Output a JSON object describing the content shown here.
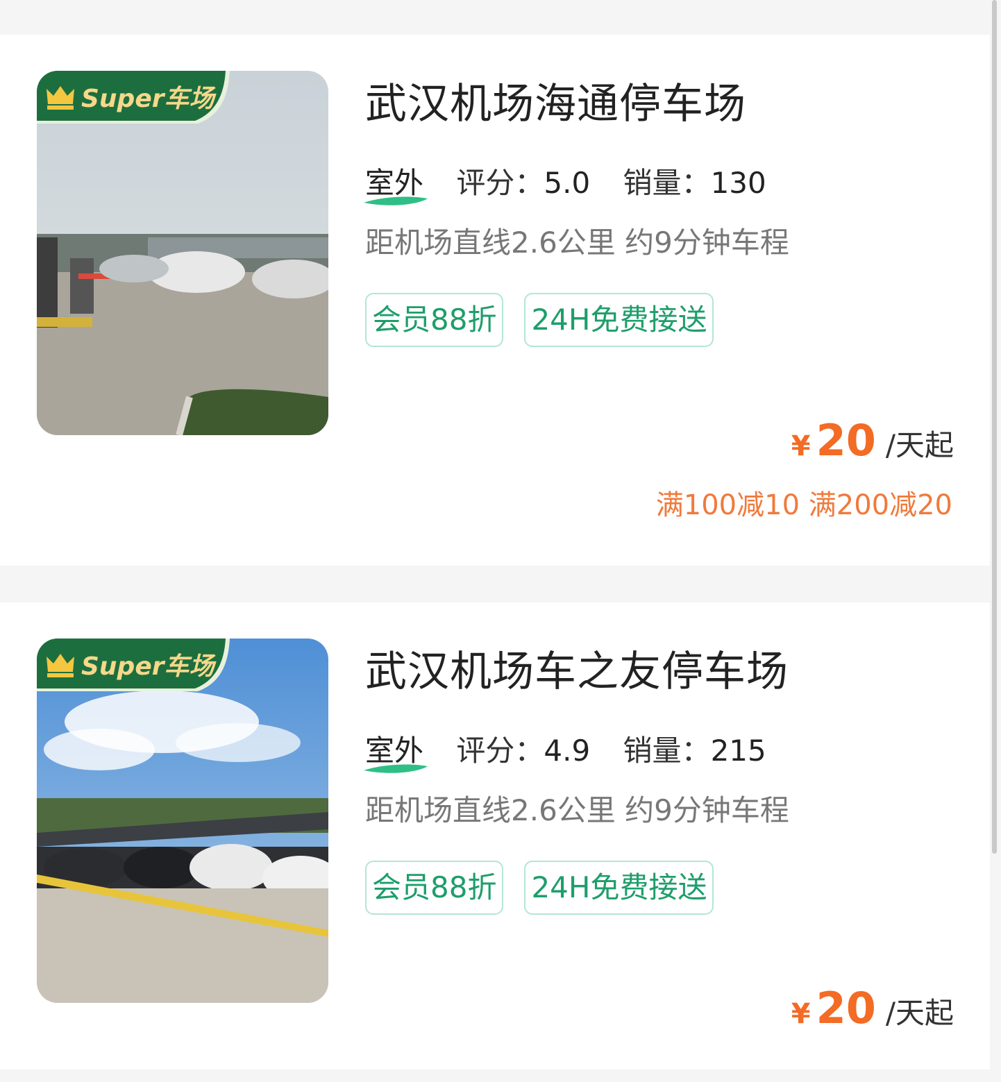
{
  "colors": {
    "price": "#f36b25",
    "tag_text": "#1e9e6b",
    "tag_border": "#b3e6d3",
    "badge_green": "#1d6e3f"
  },
  "listings": [
    {
      "title": "武汉机场海通停车场",
      "badge": {
        "text": "Super车场",
        "icon": "crown-icon"
      },
      "type": "室外",
      "rating_label": "评分：",
      "rating": "5.0",
      "sales_label": "销量：",
      "sales": "130",
      "distance": "距机场直线2.6公里 约9分钟车程",
      "tags": [
        "会员88折",
        "24H免费接送"
      ],
      "currency": "¥",
      "price": "20",
      "price_unit": "/天起",
      "discount": "满100减10 满200减20"
    },
    {
      "title": "武汉机场车之友停车场",
      "badge": {
        "text": "Super车场",
        "icon": "crown-icon"
      },
      "type": "室外",
      "rating_label": "评分：",
      "rating": "4.9",
      "sales_label": "销量：",
      "sales": "215",
      "distance": "距机场直线2.6公里 约9分钟车程",
      "tags": [
        "会员88折",
        "24H免费接送"
      ],
      "currency": "¥",
      "price": "20",
      "price_unit": "/天起"
    }
  ]
}
